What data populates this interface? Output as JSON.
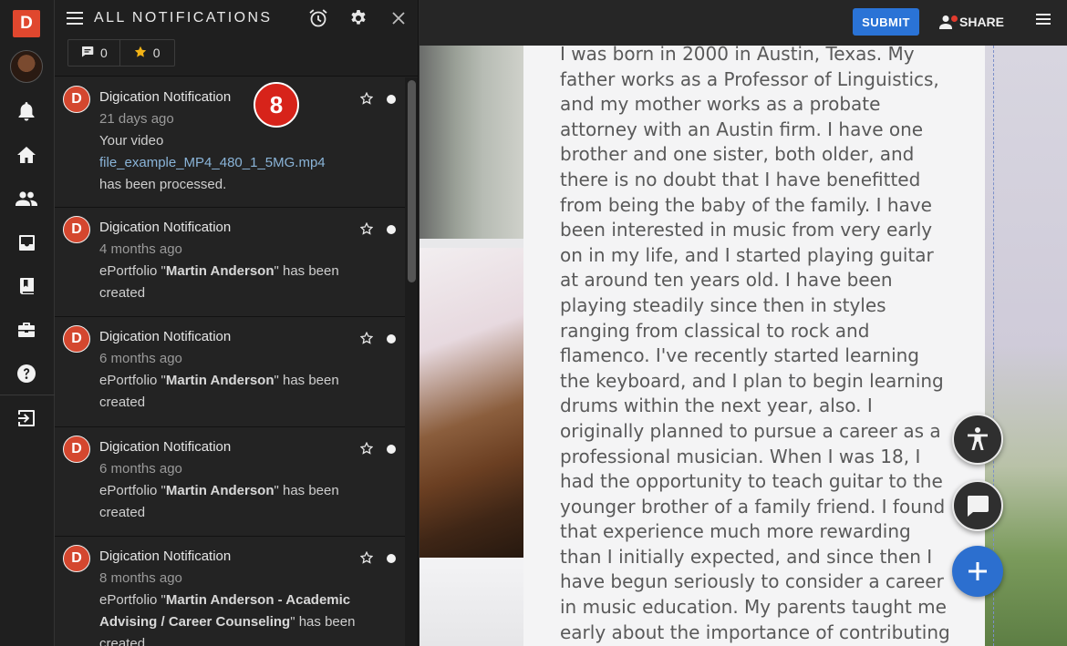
{
  "rail": {
    "logo": "D",
    "items": [
      {
        "icon": "bell-icon"
      },
      {
        "icon": "home-icon"
      },
      {
        "icon": "people-icon"
      },
      {
        "icon": "inbox-icon"
      },
      {
        "icon": "book-icon"
      },
      {
        "icon": "briefcase-icon"
      },
      {
        "icon": "help-icon"
      },
      {
        "icon": "exit-icon"
      }
    ]
  },
  "panel": {
    "title": "ALL NOTIFICATIONS",
    "filters": {
      "comments_count": "0",
      "starred_count": "0"
    },
    "badge": "8",
    "notifications": [
      {
        "avatar": "D",
        "title": "Digication Notification",
        "time": "21 days ago",
        "line1": "Your video",
        "link": "file_example_MP4_480_1_5MG.mp4",
        "line2": "has been processed."
      },
      {
        "avatar": "D",
        "title": "Digication Notification",
        "time": "4 months ago",
        "prefix": "ePortfolio \"",
        "bold": "Martin Anderson",
        "suffix": "\" has been created"
      },
      {
        "avatar": "D",
        "title": "Digication Notification",
        "time": "6 months ago",
        "prefix": "ePortfolio \"",
        "bold": "Martin Anderson",
        "suffix": "\" has been created"
      },
      {
        "avatar": "D",
        "title": "Digication Notification",
        "time": "6 months ago",
        "prefix": "ePortfolio \"",
        "bold": "Martin Anderson",
        "suffix": "\" has been created"
      },
      {
        "avatar": "D",
        "title": "Digication Notification",
        "time": "8 months ago",
        "prefix": "ePortfolio \"",
        "bold": "Martin Anderson - Academic Advising / Career Counseling",
        "suffix": "\" has been created"
      }
    ]
  },
  "topbar": {
    "submit_label": "SUBMIT",
    "share_label": "SHARE"
  },
  "essay": {
    "text": "I was born in 2000 in Austin, Texas. My father works as a Professor of Linguistics, and my mother works as a probate attorney with an Austin firm. I have one brother and one sister, both older, and there is no doubt that I have benefitted from being the baby of the family.  I have been interested in music from very early on in my life, and I started playing guitar at around ten years old. I have been playing steadily since then in styles ranging from classical to rock and flamenco. I've recently started learning the keyboard, and I plan to begin learning drums within the next year, also. I originally planned to pursue a career as a professional musician. When I was 18, I had the opportunity to teach guitar to the younger brother of a family friend. I found that experience much more rewarding than I initially expected, and since then I have begun seriously to consider a career in music education. My parents taught me early about the importance of contributing to the community"
  },
  "colors": {
    "brand": "#e0472e",
    "submit": "#2a73d6",
    "badge": "#d7231a",
    "link": "#8ab4d8"
  }
}
